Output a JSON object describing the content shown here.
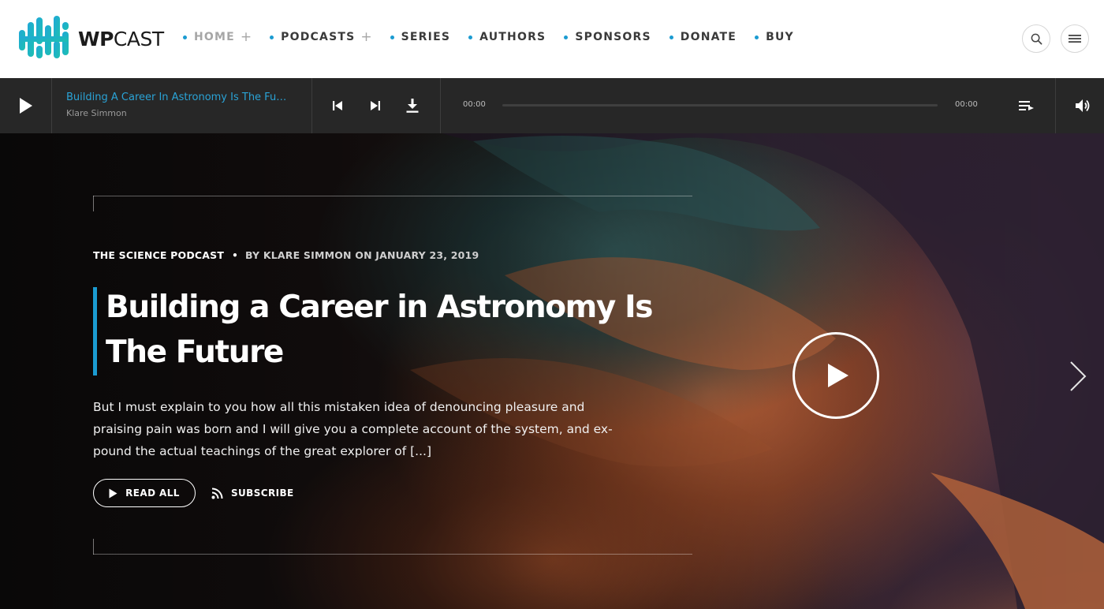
{
  "brand": {
    "logo_bold": "WP",
    "logo_light": "CAST",
    "accent_color": "#1b9bd1"
  },
  "nav": {
    "items": [
      {
        "label": "HOME",
        "has_submenu": true,
        "active": true
      },
      {
        "label": "PODCASTS",
        "has_submenu": true,
        "active": false
      },
      {
        "label": "SERIES",
        "has_submenu": false,
        "active": false
      },
      {
        "label": "AUTHORS",
        "has_submenu": false,
        "active": false
      },
      {
        "label": "SPONSORS",
        "has_submenu": false,
        "active": false
      },
      {
        "label": "DONATE",
        "has_submenu": false,
        "active": false
      },
      {
        "label": "BUY",
        "has_submenu": false,
        "active": false
      }
    ],
    "submenu_symbol": "+",
    "search_icon": "search-icon",
    "menu_icon": "hamburger-menu-icon"
  },
  "player": {
    "track_title": "Building A Career In Astronomy Is The Fu…",
    "track_artist": "Klare Simmon",
    "time_current": "00:00",
    "time_total": "00:00",
    "progress_percent": 0,
    "icons": [
      "play-icon",
      "skip-previous-icon",
      "skip-next-icon",
      "download-icon",
      "playlist-icon",
      "volume-icon"
    ]
  },
  "hero": {
    "category": "THE SCIENCE PODCAST",
    "byline": "BY KLARE SIMMON ON JANUARY 23, 2019",
    "title": "Building a Career in Astronomy Is The Future",
    "excerpt": "But I must explain to you how all this mistaken idea of denouncing pleasure and praising pain was born and I will give you a complete account of the system, and ex-pound the actual teachings of the great explorer of [...]",
    "read_all_label": "READ ALL",
    "subscribe_label": "SUBSCRIBE"
  }
}
